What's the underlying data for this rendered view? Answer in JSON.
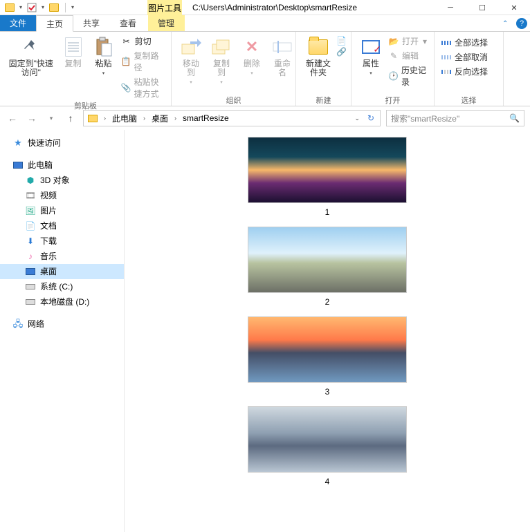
{
  "titlebar": {
    "context_tab": "图片工具",
    "path": "C:\\Users\\Administrator\\Desktop\\smartResize"
  },
  "tabs": {
    "file": "文件",
    "home": "主页",
    "share": "共享",
    "view": "查看",
    "manage": "管理"
  },
  "ribbon": {
    "pin": "固定到\"快速访问\"",
    "copy": "复制",
    "paste": "粘贴",
    "cut": "剪切",
    "copy_path": "复制路径",
    "paste_shortcut": "粘贴快捷方式",
    "clipboard": "剪贴板",
    "move_to": "移动到",
    "copy_to": "复制到",
    "delete": "删除",
    "rename": "重命名",
    "organize": "组织",
    "new_folder": "新建文件夹",
    "new": "新建",
    "properties": "属性",
    "open": "打开",
    "edit": "编辑",
    "history": "历史记录",
    "open_group": "打开",
    "select_all": "全部选择",
    "select_none": "全部取消",
    "invert_sel": "反向选择",
    "select": "选择"
  },
  "breadcrumb": {
    "pc": "此电脑",
    "desktop": "桌面",
    "folder": "smartResize"
  },
  "search": {
    "placeholder": "搜索\"smartResize\""
  },
  "nav": {
    "quick_access": "快速访问",
    "this_pc": "此电脑",
    "objects_3d": "3D 对象",
    "videos": "视频",
    "pictures": "图片",
    "documents": "文档",
    "downloads": "下载",
    "music": "音乐",
    "desktop": "桌面",
    "c_drive": "系统 (C:)",
    "d_drive": "本地磁盘 (D:)",
    "network": "网络"
  },
  "files": [
    {
      "name": "1"
    },
    {
      "name": "2"
    },
    {
      "name": "3"
    },
    {
      "name": "4"
    }
  ]
}
